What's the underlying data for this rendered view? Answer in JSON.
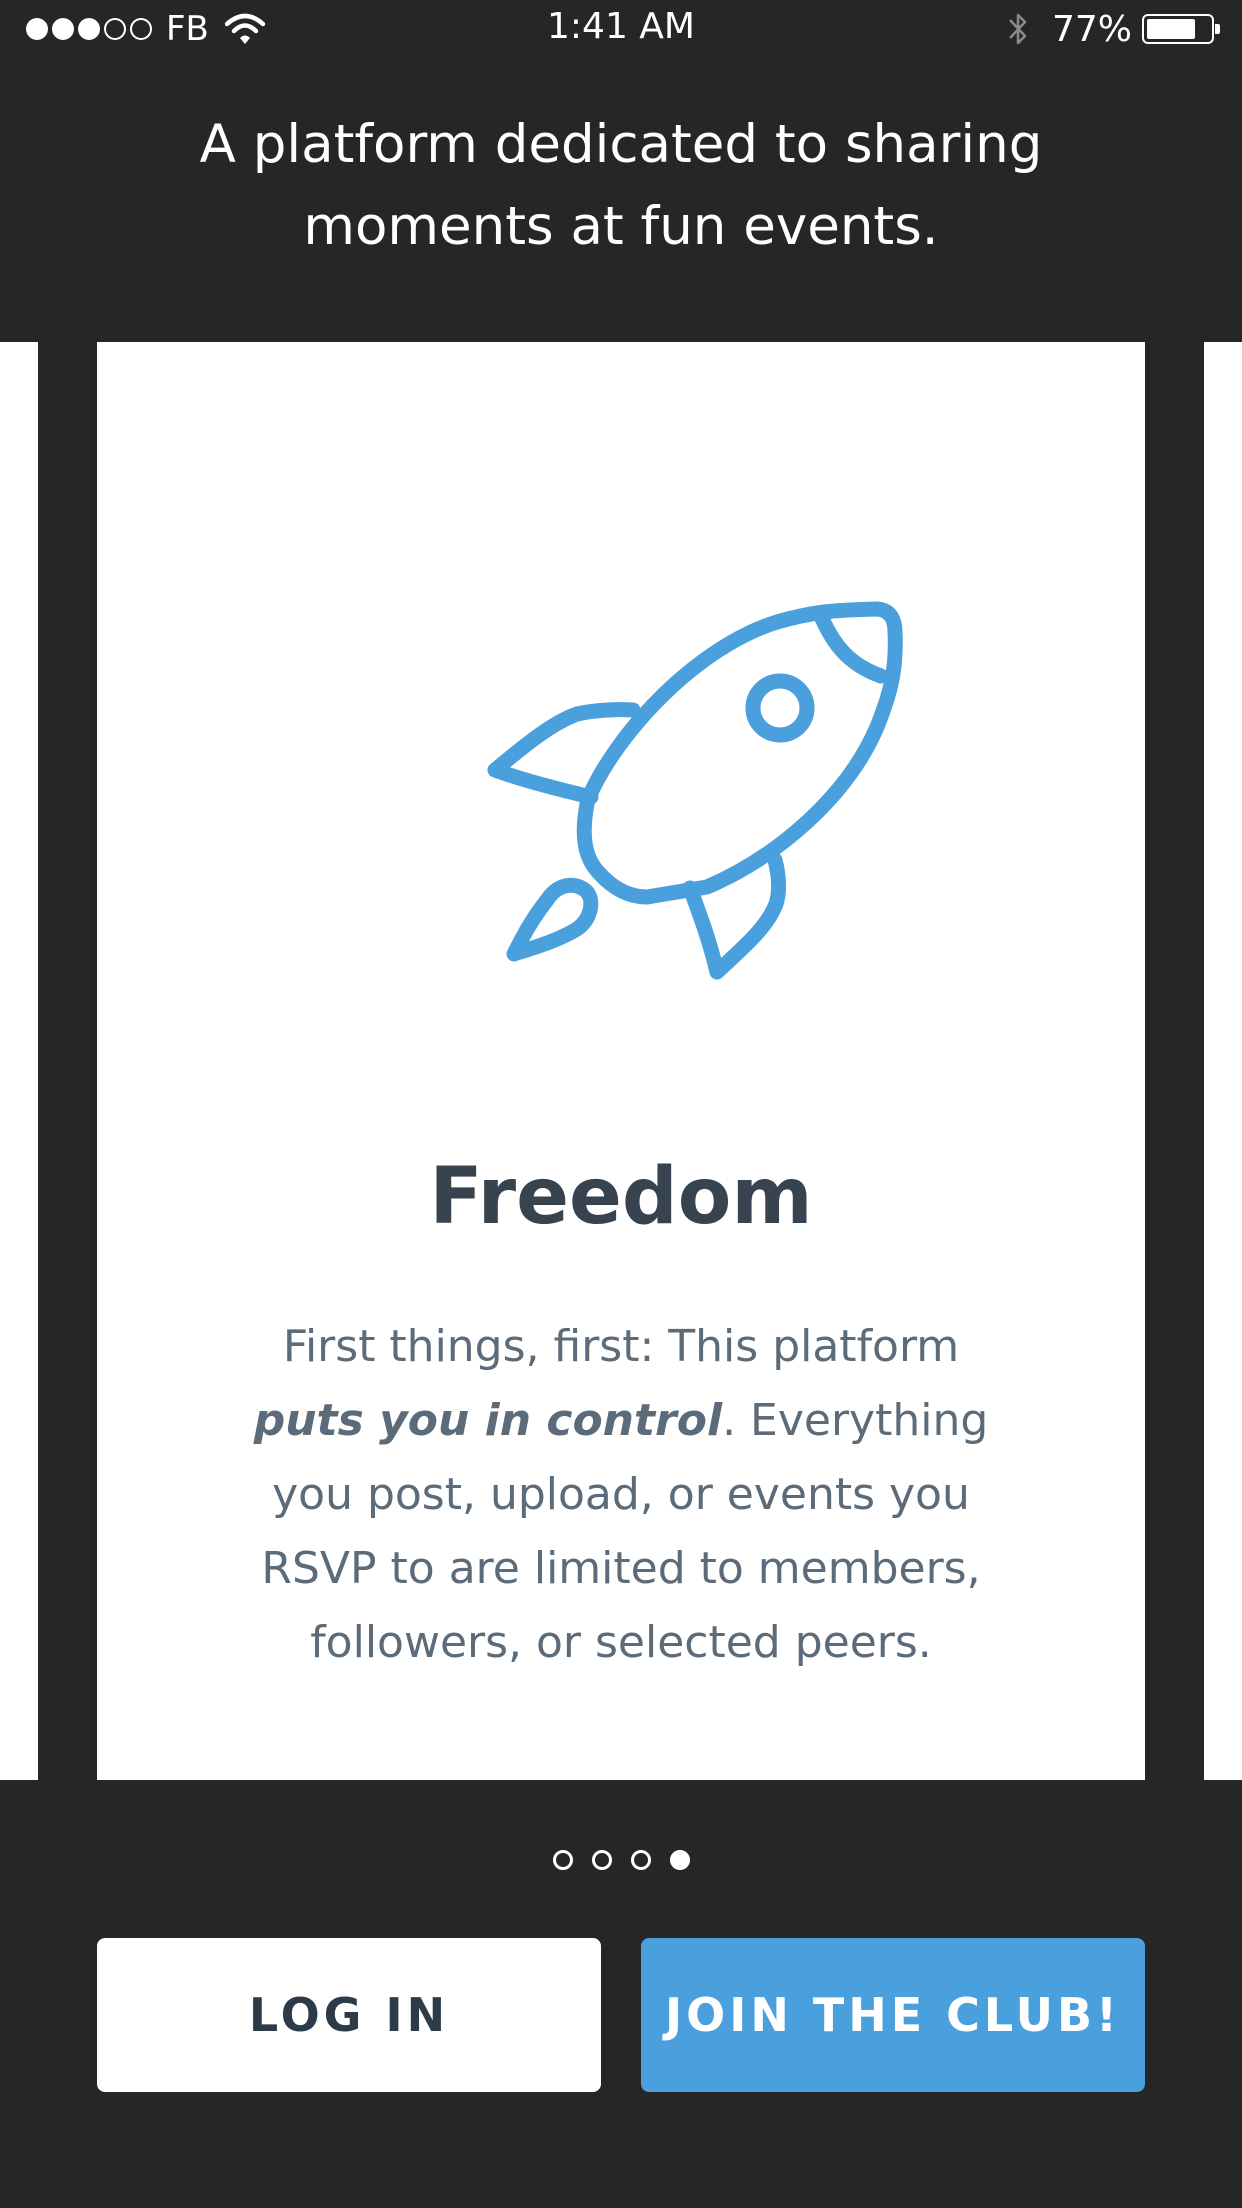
{
  "status_bar": {
    "carrier": "FB",
    "time": "1:41 AM",
    "battery_percent": "77%",
    "battery_level": 0.77,
    "signal_strength": {
      "filled": 3,
      "total": 5
    }
  },
  "header": {
    "tagline": "A platform dedicated to sharing moments at fun events."
  },
  "card": {
    "icon": "rocket-icon",
    "title": "Freedom",
    "body_before": "First things, first: This platform ",
    "body_emphasis": "puts you in control",
    "body_after": ". Everything you post, upload, or events you RSVP to are limited to members, followers, or selected peers."
  },
  "pager": {
    "total": 4,
    "active_index": 3
  },
  "buttons": {
    "login_label": "LOG IN",
    "join_label": "JOIN THE CLUB!"
  },
  "colors": {
    "background": "#262626",
    "accent": "#4a9fdd",
    "title_text": "#37434f",
    "body_text": "#5b6b7a"
  }
}
